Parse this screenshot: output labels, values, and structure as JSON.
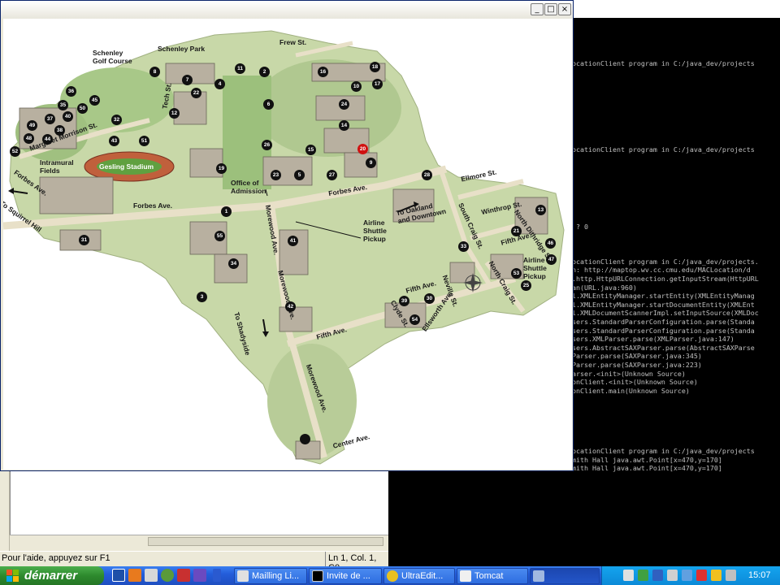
{
  "editor": {
    "status_help": "Pour l'aide, appuyez sur F1",
    "status_position": "Ln 1, Col. 1, C0"
  },
  "console": {
    "lines": [
      "",
      "",
      "ocationClient program in C:/java_dev/projects",
      "",
      "",
      "",
      "",
      "",
      "",
      "",
      "",
      "",
      "ocationClient program in C:/java_dev/projects",
      "",
      "",
      "",
      "",
      "",
      "",
      "",
      "",
      " ? 0",
      "",
      "",
      "",
      "ocationClient program in C:/java_dev/projects.",
      "n: http://maptop.wv.cc.cmu.edu/MACLocation/d",
      ".http.HttpURLConnection.getInputStream(HttpURL",
      "an(URL.java:960)",
      "l.XMLEntityManager.startEntity(XMLEntityManag",
      "l.XMLEntityManager.startDocumentEntity(XMLEnt",
      "l.XMLDocumentScannerImpl.setInputSource(XMLDoc",
      "sers.StandardParserConfiguration.parse(Standa",
      "sers.StandardParserConfiguration.parse(Standa",
      "sers.XMLParser.parse(XMLParser.java:147)",
      "sers.AbstractSAXParser.parse(AbstractSAXParse",
      "Parser.parse(SAXParser.java:345)",
      "Parser.parse(SAXParser.java:223)",
      "arser.<init>(Unknown Source)",
      "onClient.<init>(Unknown Source)",
      "onClient.main(Unknown Source)",
      "",
      "",
      "",
      "",
      "",
      "",
      "ocationClient program in C:/java_dev/projects",
      "mith Hall java.awt.Point[x=470,y=170]",
      "mith Hall java.awt.Point[x=470,y=170]"
    ]
  },
  "map_window": {
    "title_buttons": [
      "_",
      "□",
      "×"
    ],
    "labels": {
      "frew": "Frew St.",
      "schenley_park": "Schenley Park",
      "schenley_golf": "Schenley\nGolf Course",
      "intramural": "Intramural\nFields",
      "gesling": "Gesling Stadium",
      "margaret": "Margaret Morrison St.",
      "forbes1": "Forbes Ave.",
      "forbes2": "Forbes Ave.",
      "forbes3": "Forbes Ave.",
      "squirrel": "To Squirrel Hill",
      "admission": "Office of\nAdmission",
      "oakland": "To Oakland\nand Downtown",
      "airline1": "Airline\nShuttle\nPickup",
      "airline2": "Airline\nShuttle\nPickup",
      "ellmore": "Ellmore St.",
      "winthrop": "Winthrop St.",
      "south_craig": "South Craig St.",
      "north_craig": "North Craig St.",
      "north_dithridge": "North Dithridge St.",
      "fifth1": "Fifth Ave.",
      "fifth2": "Fifth Ave.",
      "fifth3": "Fifth Ave.",
      "morewood1": "Morewood Ave.",
      "morewood2": "Morewood Ave.",
      "morewood3": "Morewood Ave.",
      "shadyside": "To Shadyside",
      "neville": "Neville St.",
      "clyde": "Clyde St.",
      "ellsworth": "Ellsworth Ave.",
      "center": "Center Ave.",
      "tech": "Tech St."
    },
    "buildings": [
      "1",
      "2",
      "3",
      "4",
      "5",
      "6",
      "7",
      "8",
      "9",
      "10",
      "11",
      "12",
      "13",
      "14",
      "15",
      "16",
      "17",
      "18",
      "19",
      "20",
      "21",
      "22",
      "23",
      "24",
      "25",
      "26",
      "27",
      "28",
      "30",
      "31",
      "32",
      "33",
      "34",
      "35",
      "36",
      "37",
      "38",
      "39",
      "40",
      "41",
      "42",
      "43",
      "44",
      "45",
      "46",
      "47",
      "48",
      "49",
      "50",
      "51",
      "52",
      "53",
      "54",
      "55"
    ]
  },
  "taskbar": {
    "start_label": "démarrer",
    "tasks": [
      "Mailling Li...",
      "Invite de ...",
      "UltraEdit...",
      "Tomcat",
      ""
    ],
    "clock": "15:07"
  },
  "colors": {
    "taskbar_blue": "#245ddb",
    "start_green": "#2d8a2d",
    "tray_blue": "#0c8ad8",
    "console_bg": "#000000",
    "console_text": "#c0c0c0"
  }
}
